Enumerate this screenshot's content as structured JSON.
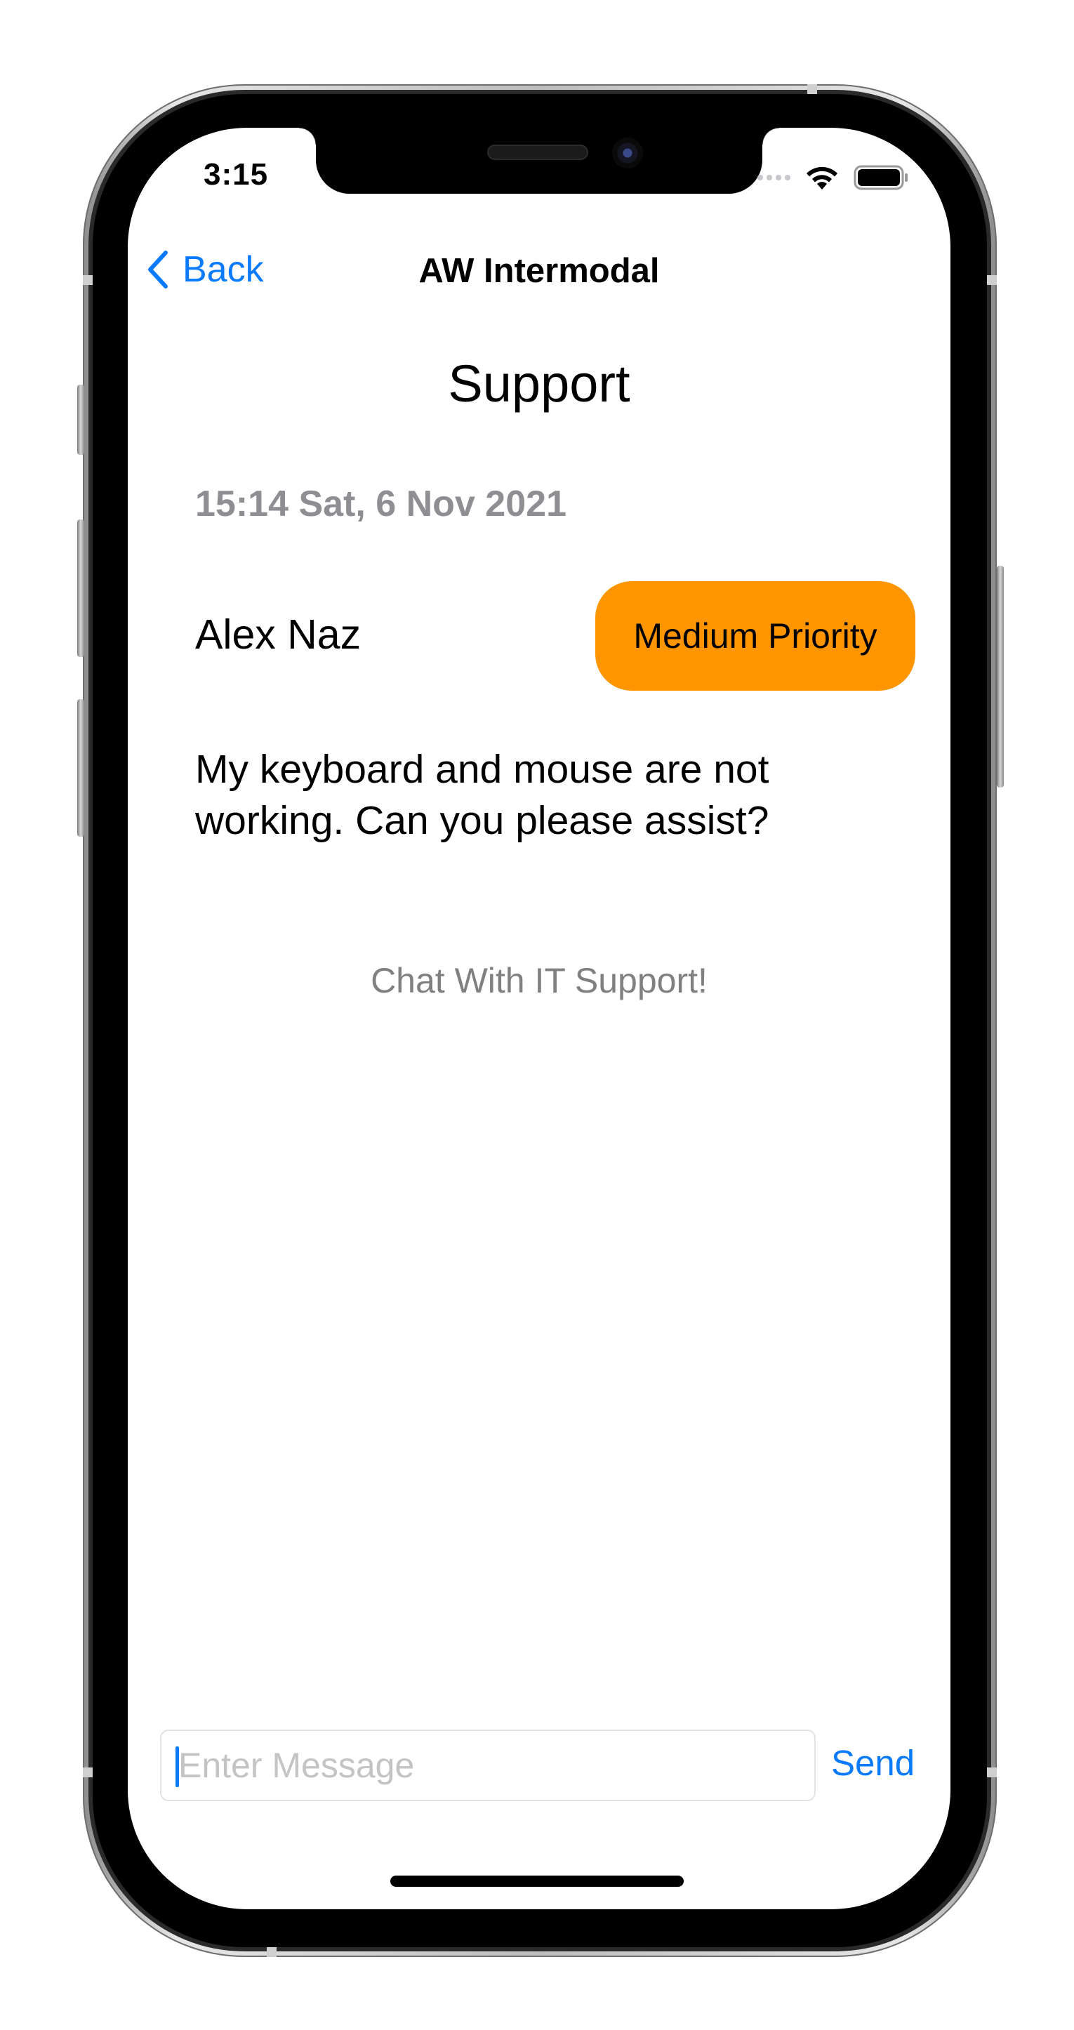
{
  "status_bar": {
    "time": "3:15",
    "icons": [
      "cellular-signal-icon",
      "wifi-icon",
      "battery-icon"
    ]
  },
  "nav": {
    "back_label": "Back",
    "title": "AW Intermodal"
  },
  "ticket": {
    "heading": "Support",
    "timestamp": "15:14 Sat, 6 Nov 2021",
    "user_name": "Alex Naz",
    "priority_label": "Medium Priority",
    "message": "My keyboard and mouse are not working. Can you please assist?"
  },
  "chat": {
    "hint": "Chat With IT Support!",
    "input_placeholder": "Enter Message",
    "input_value": "",
    "send_label": "Send"
  },
  "colors": {
    "accent": "#0a7aff",
    "priority_medium": "#ff9500",
    "secondary_text": "#8e8e93"
  }
}
